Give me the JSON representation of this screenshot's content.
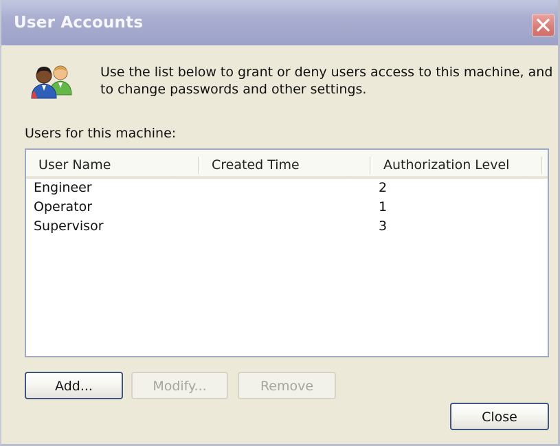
{
  "window": {
    "title": "User Accounts",
    "close_icon": "close-x-icon"
  },
  "intro": {
    "icon": "users-icon",
    "text": "Use the list below to grant or deny users access to this machine, and to change passwords and other settings."
  },
  "users_label": "Users for this machine:",
  "list": {
    "columns": [
      "User Name",
      "Created Time",
      "Authorization Level"
    ],
    "rows": [
      {
        "user_name": "Engineer",
        "created_time": "",
        "authorization_level": "2"
      },
      {
        "user_name": "Operator",
        "created_time": "",
        "authorization_level": "1"
      },
      {
        "user_name": "Supervisor",
        "created_time": "",
        "authorization_level": "3"
      }
    ]
  },
  "buttons": {
    "add": {
      "label": "Add...",
      "enabled": true
    },
    "modify": {
      "label": "Modify...",
      "enabled": false
    },
    "remove": {
      "label": "Remove",
      "enabled": false
    },
    "close": {
      "label": "Close",
      "enabled": true
    }
  },
  "colors": {
    "titlebar": "#a9aed0",
    "dialog_bg": "#ece9d8",
    "close_button": "#d9807b",
    "button_border": "#40557e"
  }
}
